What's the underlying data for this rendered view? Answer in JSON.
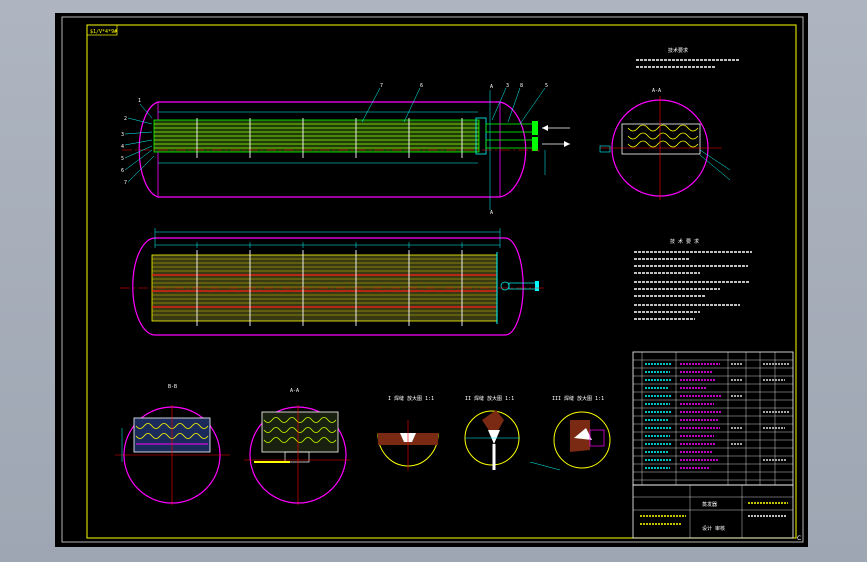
{
  "view_label": "$1/V*4*9#",
  "frame_corner_label": "C",
  "section_a_label": "A-A",
  "section_b_label": "B-B",
  "section_c_label": "A-A",
  "detail_labels": [
    "I 焊缝 放大图 1:1",
    "II 焊缝 放大图 1:1",
    "III 焊缝 放大图 1:1"
  ],
  "tech_req_title_1": "技术要求",
  "tech_req_title_2": "技 术 要 求",
  "title_block_name": "蒸发器",
  "title_block_sub": "设计 审核",
  "colors": {
    "background": "#000000",
    "frame": "#ffff00",
    "outline": "#ff00ff",
    "tube": "#00ff00",
    "baffle": "#ffffff",
    "center": "#ff0000",
    "dimension": "#00ffff"
  }
}
